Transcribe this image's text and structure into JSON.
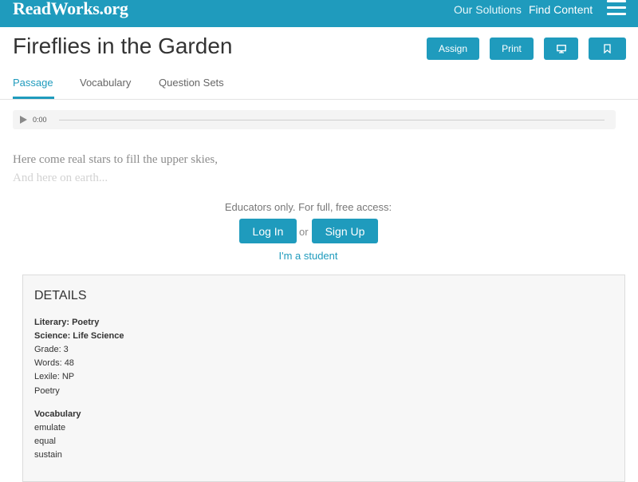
{
  "header": {
    "logo": "ReadWorks.org",
    "nav": [
      "Our Solutions",
      "Find Content"
    ],
    "menu_icon": "hamburger-icon"
  },
  "page": {
    "title": "Fireflies in the Garden",
    "buttons": {
      "assign": "Assign",
      "print": "Print",
      "present_icon": "monitor-icon",
      "bookmark_icon": "bookmark-icon"
    },
    "tabs": [
      {
        "label": "Passage",
        "active": true
      },
      {
        "label": "Vocabulary",
        "active": false
      },
      {
        "label": "Question Sets",
        "active": false
      }
    ]
  },
  "audio": {
    "play_icon": "play-icon",
    "time": "0:00"
  },
  "passage": {
    "lines": [
      "Here come real stars to fill the upper skies,",
      "And here on earth..."
    ]
  },
  "access": {
    "message": "Educators only. For full, free access:",
    "login": "Log In",
    "or": "or",
    "signup": "Sign Up",
    "student": "I'm a student"
  },
  "details": {
    "heading": "DETAILS",
    "literary": "Literary: Poetry",
    "science": "Science: Life Science",
    "grade": "Grade: 3",
    "words": "Words: 48",
    "lexile": "Lexile: NP",
    "genre": "Poetry",
    "vocab_heading": "Vocabulary",
    "vocab": [
      "emulate",
      "equal",
      "sustain"
    ]
  },
  "colors": {
    "brand": "#1f9bbd",
    "text": "#333333"
  }
}
